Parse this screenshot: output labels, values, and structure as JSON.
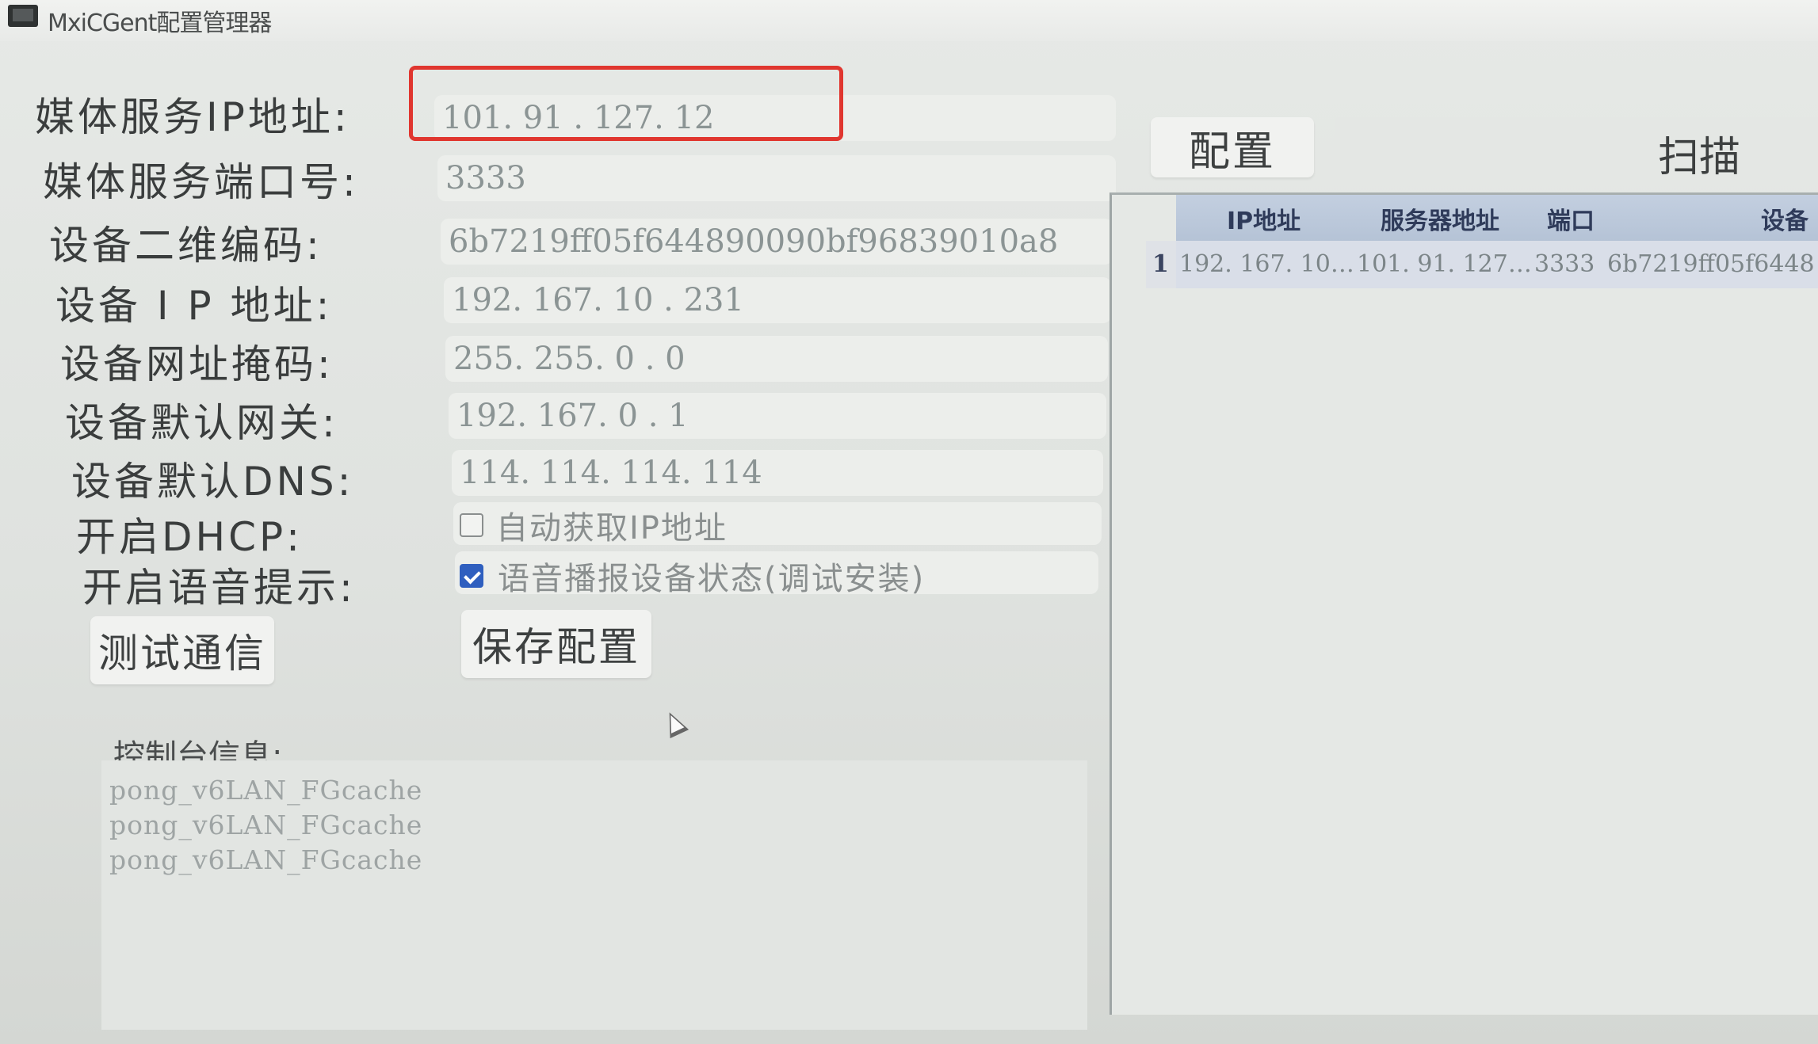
{
  "window": {
    "title": "MxiCGent配置管理器"
  },
  "form": {
    "fields": [
      {
        "label": "媒体服务IP地址:",
        "value": "101. 91  . 127. 12"
      },
      {
        "label": "媒体服务端口号:",
        "value": "3333"
      },
      {
        "label": "设备二维编码:",
        "value": "6b7219ff05f644890090bf96839010a8"
      },
      {
        "label": "设备 I P 地址:",
        "value": "192. 167. 10  . 231"
      },
      {
        "label": "设备网址掩码:",
        "value": "255. 255. 0   . 0"
      },
      {
        "label": "设备默认网关:",
        "value": "192. 167. 0   . 1"
      },
      {
        "label": "设备默认DNS:",
        "value": "114. 114. 114. 114"
      }
    ],
    "dhcp": {
      "label": "开启DHCP:",
      "option": "自动获取IP地址",
      "checked": false
    },
    "voice": {
      "label": "开启语音提示:",
      "option": "语音播报设备状态(调试安装)",
      "checked": true
    },
    "test_button": "测试通信",
    "save_button": "保存配置"
  },
  "console": {
    "label": "控制台信息:",
    "lines": [
      "pong_v6LAN_FGcache",
      "pong_v6LAN_FGcache",
      "pong_v6LAN_FGcache"
    ]
  },
  "right_panel": {
    "tab_config": "配置",
    "tab_scan": "扫描",
    "table": {
      "headers": [
        "IP地址",
        "服务器地址",
        "端口",
        "设备"
      ],
      "rows": [
        {
          "num": "1",
          "cells": [
            "192. 167. 10…",
            "101. 91. 127…",
            "3333",
            "6b7219ff05f6448"
          ]
        }
      ]
    }
  },
  "colors": {
    "highlight_box": "#e0362f",
    "checkbox_checked": "#2f5fbf",
    "table_header": "#b5c3d6"
  }
}
